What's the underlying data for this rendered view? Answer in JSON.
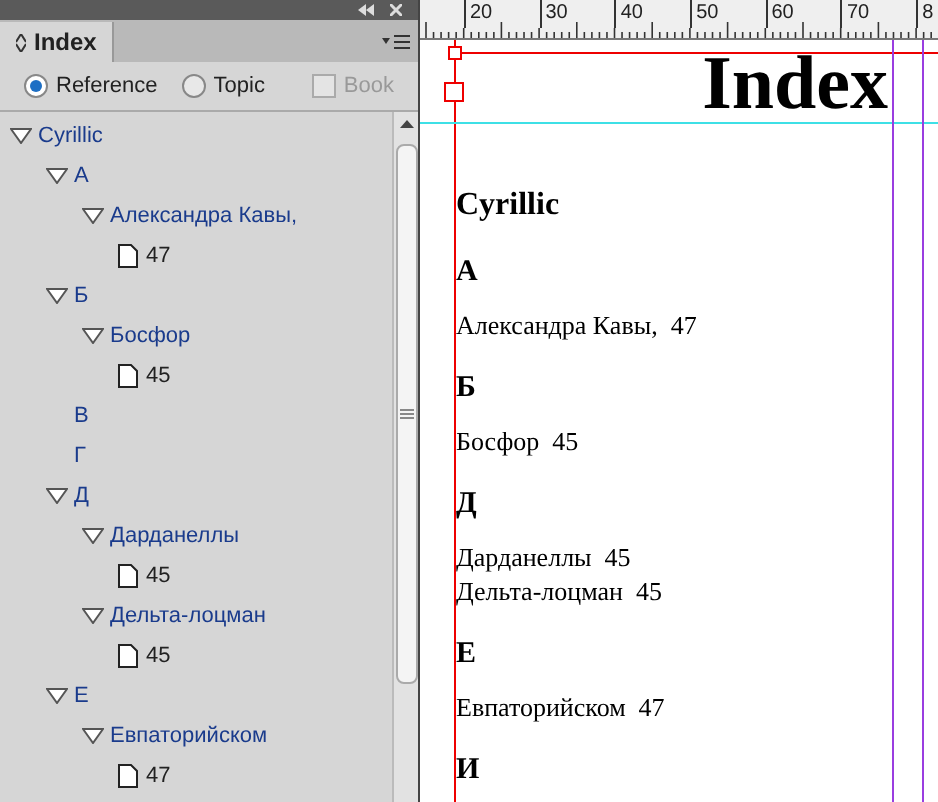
{
  "panel": {
    "tab": {
      "label": "Index"
    },
    "options": [
      {
        "label": "Reference",
        "selected": true
      },
      {
        "label": "Topic",
        "selected": false
      }
    ],
    "book": {
      "label": "Book",
      "checked": false,
      "disabled": true
    },
    "tree": [
      {
        "label": "Cyrillic",
        "kind": "topic",
        "expanded": true,
        "children": [
          {
            "label": "А",
            "kind": "topic",
            "expanded": true,
            "children": [
              {
                "label": "Александра Кавы,",
                "kind": "topic",
                "expanded": true,
                "children": [
                  {
                    "label": "47",
                    "kind": "page"
                  }
                ]
              }
            ]
          },
          {
            "label": "Б",
            "kind": "topic",
            "expanded": true,
            "children": [
              {
                "label": "Босфор",
                "kind": "topic",
                "expanded": true,
                "children": [
                  {
                    "label": "45",
                    "kind": "page"
                  }
                ]
              }
            ]
          },
          {
            "label": "В",
            "kind": "leaf"
          },
          {
            "label": "Г",
            "kind": "leaf"
          },
          {
            "label": "Д",
            "kind": "topic",
            "expanded": true,
            "children": [
              {
                "label": "Дарданеллы",
                "kind": "topic",
                "expanded": true,
                "children": [
                  {
                    "label": "45",
                    "kind": "page"
                  }
                ]
              },
              {
                "label": "Дельта-лоцман",
                "kind": "topic",
                "expanded": true,
                "children": [
                  {
                    "label": "45",
                    "kind": "page"
                  }
                ]
              }
            ]
          },
          {
            "label": "Е",
            "kind": "topic",
            "expanded": true,
            "children": [
              {
                "label": "Евпаторийском",
                "kind": "topic",
                "expanded": true,
                "children": [
                  {
                    "label": "47",
                    "kind": "page"
                  }
                ]
              }
            ]
          }
        ]
      }
    ]
  },
  "ruler": {
    "labels": [
      "20",
      "30",
      "40",
      "50",
      "60",
      "70",
      "8"
    ]
  },
  "document": {
    "title": "Index",
    "heading": "Cyrillic",
    "sections": [
      {
        "letter": "А",
        "entries": [
          {
            "text": "Александра Кавы,",
            "page": "47"
          }
        ]
      },
      {
        "letter": "Б",
        "entries": [
          {
            "text": "Босфор",
            "page": "45"
          }
        ]
      },
      {
        "letter": "Д",
        "entries": [
          {
            "text": "Дарданеллы",
            "page": "45"
          },
          {
            "text": "Дельта-лоцман",
            "page": "45"
          }
        ]
      },
      {
        "letter": "Е",
        "entries": [
          {
            "text": "Евпаторийском",
            "page": "47"
          }
        ]
      },
      {
        "letter": "И"
      }
    ]
  }
}
